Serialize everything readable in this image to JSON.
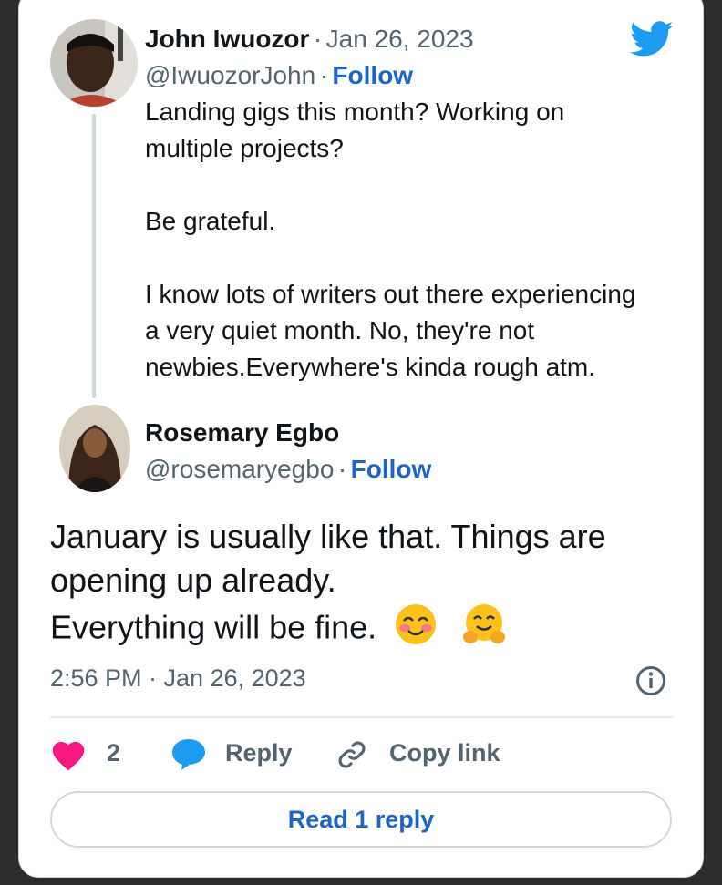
{
  "original_tweet": {
    "author_name": "John Iwuozor",
    "separator": "·",
    "date": "Jan 26, 2023",
    "handle": "@IwuozorJohn",
    "follow_label": "Follow",
    "text_lines": [
      "Landing gigs this month? Working on",
      "multiple projects?",
      "Be grateful.",
      "I know lots of writers out there experiencing",
      "a very quiet month. No, they're not",
      "newbies.Everywhere's kinda rough atm."
    ]
  },
  "reply_tweet": {
    "author_name": "Rosemary Egbo",
    "handle": "@rosemaryegbo",
    "follow_label": "Follow",
    "text_lines": [
      "January is usually like that. Things are",
      "opening up already.",
      "Everything will be fine."
    ],
    "timestamp": "2:56 PM · Jan 26, 2023"
  },
  "actions": {
    "like_count": "2",
    "reply_label": "Reply",
    "copy_link_label": "Copy link"
  },
  "read_replies_label": "Read 1 reply",
  "colors": {
    "brand_blue": "#1d9bf0",
    "link_blue": "#1d64c8",
    "heart_pink": "#f91880",
    "text_dark": "#0f1419",
    "text_grey": "#536471"
  },
  "icons": [
    "twitter-bird-icon",
    "heart-icon",
    "reply-bubble-icon",
    "link-icon",
    "info-icon",
    "smiling-face-emoji",
    "hugging-face-emoji"
  ]
}
